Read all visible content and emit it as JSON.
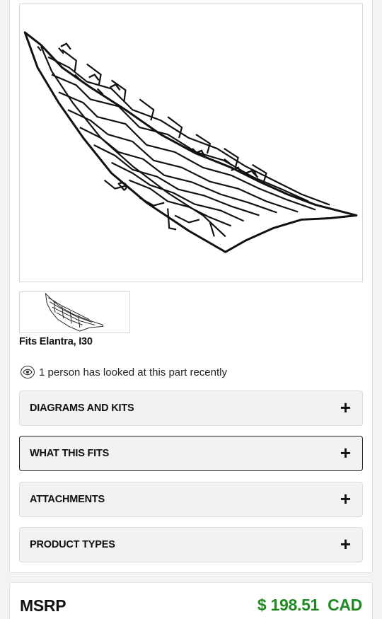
{
  "product": {
    "fitment_text": "Fits Elantra, I30",
    "image_label": "grille-assembly"
  },
  "activity": {
    "views_text": "1 person has looked at this part recently",
    "icon": "eye-icon"
  },
  "accordions": [
    {
      "label": "DIAGRAMS AND KITS",
      "icon": "plus-icon"
    },
    {
      "label": "WHAT THIS FITS",
      "icon": "plus-icon"
    },
    {
      "label": "ATTACHMENTS",
      "icon": "plus-icon"
    },
    {
      "label": "PRODUCT TYPES",
      "icon": "plus-icon"
    }
  ],
  "pricing": {
    "label": "MSRP",
    "amount": "$ 198.51",
    "currency": "CAD",
    "price_color": "#1f8a1f"
  }
}
